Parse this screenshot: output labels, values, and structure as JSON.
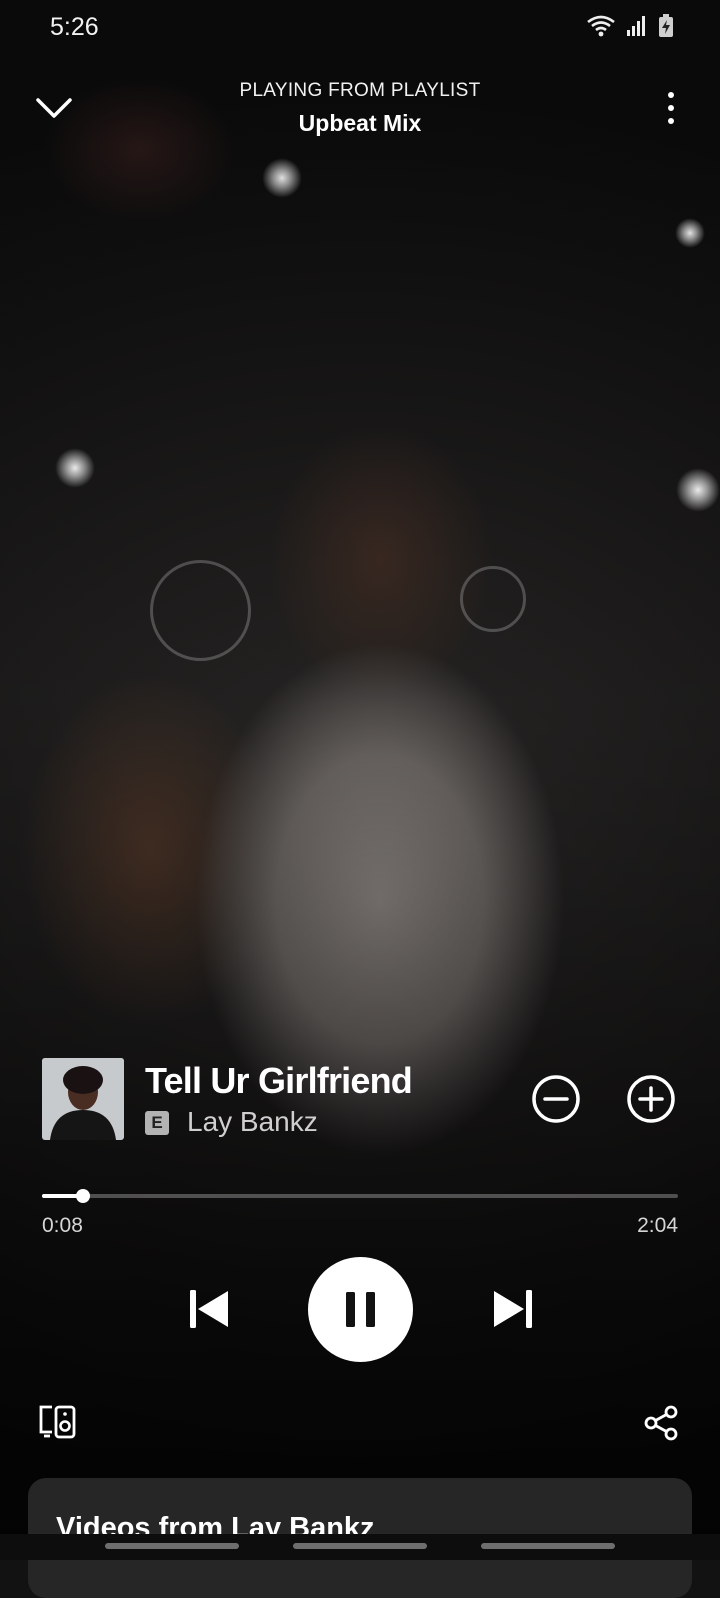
{
  "status_bar": {
    "time": "5:26"
  },
  "header": {
    "context_label": "PLAYING FROM PLAYLIST",
    "playlist_name": "Upbeat Mix"
  },
  "track": {
    "title": "Tell Ur Girlfriend",
    "explicit_badge": "E",
    "artist": "Lay Bankz"
  },
  "playback": {
    "elapsed": "0:08",
    "total": "2:04",
    "progress_fraction": 0.065
  },
  "videos_section": {
    "title": "Videos from Lay Bankz"
  },
  "icons": {
    "collapse": "chevron-down-icon",
    "more": "more-vertical-icon",
    "remove": "minus-circle-icon",
    "add": "plus-circle-icon",
    "previous": "skip-previous-icon",
    "pause": "pause-icon",
    "next": "skip-next-icon",
    "devices": "devices-icon",
    "share": "share-icon"
  },
  "colors": {
    "accent": "#ffffff",
    "card": "#262626"
  }
}
